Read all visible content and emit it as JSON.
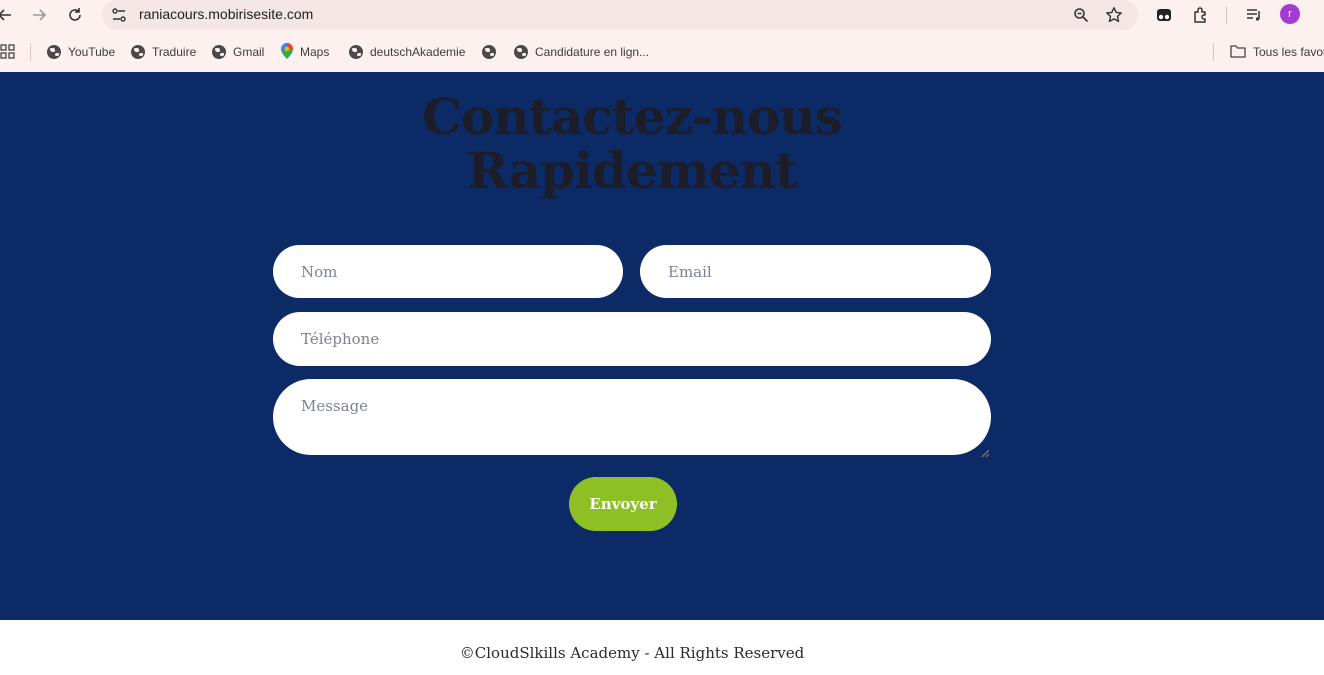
{
  "browser": {
    "url": "raniacours.mobirisesite.com",
    "profile_initial": "r",
    "bookmarks": [
      {
        "label": "YouTube",
        "icon": "globe-icon"
      },
      {
        "label": "Traduire",
        "icon": "globe-icon"
      },
      {
        "label": "Gmail",
        "icon": "globe-icon"
      },
      {
        "label": "Maps",
        "icon": "maps-pin-icon"
      },
      {
        "label": "deutschAkademie",
        "icon": "globe-icon"
      },
      {
        "label": "",
        "icon": "globe-icon"
      },
      {
        "label": "Candidature en lign...",
        "icon": "globe-icon"
      }
    ],
    "all_bookmarks_label": "Tous les favoris"
  },
  "page": {
    "title_line1": "Contactez-nous",
    "title_line2": "Rapidement",
    "form": {
      "name_placeholder": "Nom",
      "email_placeholder": "Email",
      "phone_placeholder": "Téléphone",
      "message_placeholder": "Message",
      "submit_label": "Envoyer"
    },
    "footer_text": "©CloudSlkills Academy - All Rights Reserved",
    "colors": {
      "hero_background": "#0c2b66",
      "button": "#8cc024",
      "browser_chrome": "#fdf1ef"
    }
  }
}
